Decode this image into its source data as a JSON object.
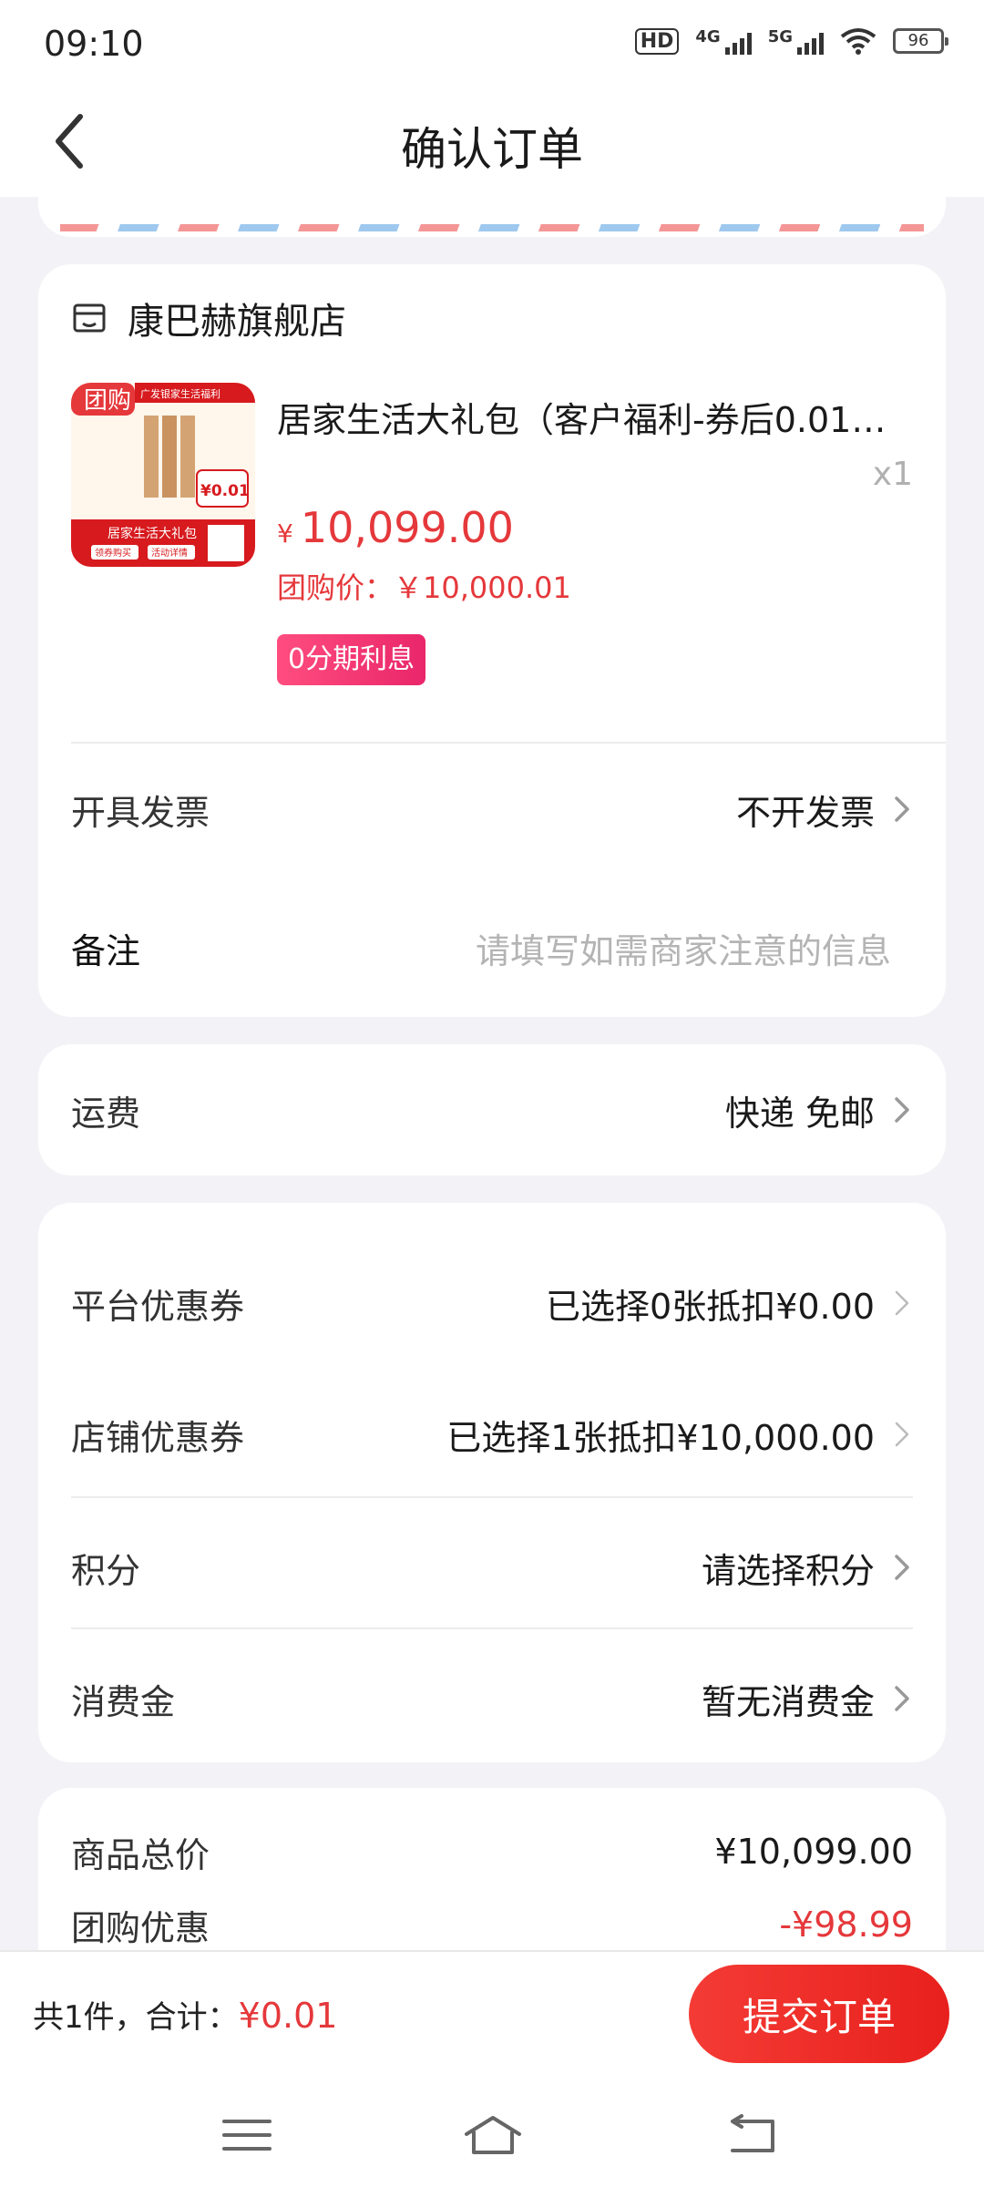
{
  "status_bar": {
    "time": "09:10",
    "hd": "HD",
    "sim1": "4G",
    "sim2": "5G",
    "battery": "96"
  },
  "navbar": {
    "title": "确认订单",
    "back_icon": "chevron-left-icon"
  },
  "shop": {
    "name": "康巴赫旗舰店",
    "icon": "store-icon"
  },
  "product": {
    "title": "居家生活大礼包（客户福利-券后0.01…",
    "quantity": "x1",
    "currency": "¥",
    "price": "10,099.00",
    "group_price": "团购价：￥10,000.01",
    "installment_badge": "0分期利息",
    "image": {
      "corner_tag": "团购",
      "banner": "广发银家生活福利",
      "price_tag": "¥0.01",
      "caption": "居家生活大礼包",
      "btn_left": "领券购买",
      "btn_right": "活动详情"
    }
  },
  "order_options": {
    "invoice": {
      "label": "开具发票",
      "value": "不开发票"
    },
    "remark": {
      "label": "备注",
      "placeholder": "请填写如需商家注意的信息"
    }
  },
  "shipping": {
    "label": "运费",
    "value": "快递 免邮"
  },
  "discounts": {
    "platform_coupon": {
      "label": "平台优惠券",
      "value": "已选择0张抵扣¥0.00"
    },
    "store_coupon": {
      "label": "店铺优惠券",
      "value": "已选择1张抵扣¥10,000.00"
    },
    "points": {
      "label": "积分",
      "value": "请选择积分"
    },
    "consumption_credit": {
      "label": "消费金",
      "value": "暂无消费金"
    }
  },
  "summary": {
    "goods_total": {
      "label": "商品总价",
      "value": "¥10,099.00"
    },
    "group_discount": {
      "label": "团购优惠",
      "value": "-¥98.99"
    }
  },
  "footer": {
    "count_label": "共1件，合计：",
    "total": "¥0.01",
    "submit_label": "提交订单"
  },
  "system_nav": {
    "menu_icon": "menu-icon",
    "home_icon": "home-icon",
    "back_icon": "back-icon"
  },
  "colors": {
    "accent_red": "#e5383b",
    "badge_pink": "#ff4d7f",
    "background": "#f3f3f7"
  }
}
